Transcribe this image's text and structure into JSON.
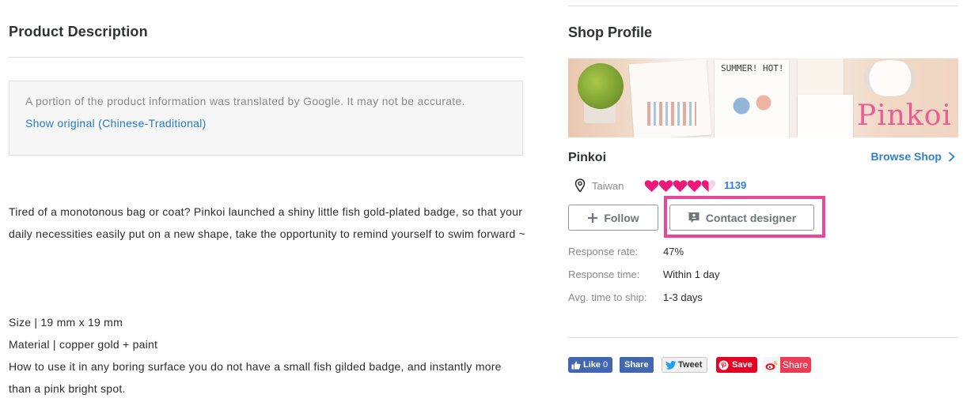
{
  "product": {
    "title": "Product Description",
    "notice_line": "A portion of the product information was translated by Google. It may not be accurate.",
    "show_original_link": "Show original (Chinese-Traditional)",
    "description": "Tired of a monotonous bag or coat? Pinkoi launched a shiny little fish gold-plated badge, so that your daily necessities easily put on a new shape, take the opportunity to remind yourself to swim forward ~",
    "spec_size": "Size | 19 mm x 19 mm",
    "spec_material": "Material | copper gold + paint",
    "spec_usage": "How to use it in any boring surface you do not have a small fish gilded badge, and instantly more than a pink bright spot."
  },
  "shop": {
    "title": "Shop Profile",
    "banner": {
      "caption": "SUMMER! HOT!",
      "logo": "Pinkoi"
    },
    "name": "Pinkoi",
    "browse_label": "Browse Shop",
    "location": "Taiwan",
    "rating_stars": 4.5,
    "rating_count": "1139",
    "follow_label": "Follow",
    "contact_label": "Contact designer",
    "stats": [
      {
        "label": "Response rate:",
        "value": "47%"
      },
      {
        "label": "Response time:",
        "value": "Within 1 day"
      },
      {
        "label": "Avg. time to ship:",
        "value": "1-3 days"
      }
    ]
  },
  "social": {
    "fb_like": "Like",
    "fb_like_count": "0",
    "fb_share": "Share",
    "tweet": "Tweet",
    "pinterest": "Save",
    "weibo": "Share"
  },
  "colors": {
    "link_blue": "#2f7fd1",
    "heart_pink": "#f0177a",
    "highlight_pink": "#e8479a",
    "facebook": "#4267b2",
    "pinterest": "#e60023",
    "weibo": "#ed3b55"
  }
}
